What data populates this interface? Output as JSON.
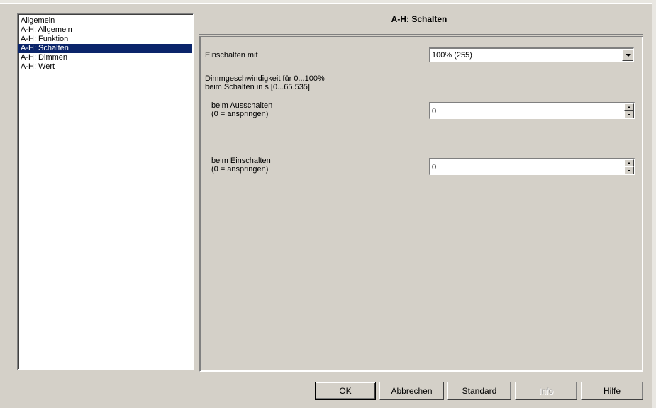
{
  "nav": {
    "items": [
      {
        "label": "Allgemein",
        "selected": false
      },
      {
        "label": "A-H: Allgemein",
        "selected": false
      },
      {
        "label": "A-H: Funktion",
        "selected": false
      },
      {
        "label": "A-H: Schalten",
        "selected": true
      },
      {
        "label": "A-H: Dimmen",
        "selected": false
      },
      {
        "label": "A-H: Wert",
        "selected": false
      }
    ]
  },
  "page": {
    "title": "A-H: Schalten"
  },
  "form": {
    "einschalten_mit": {
      "label": "Einschalten mit",
      "value": "100% (255)"
    },
    "dimm_heading": {
      "line1": "Dimmgeschwindigkeit für 0...100%",
      "line2": "beim Schalten in s [0...65.535]"
    },
    "ausschalten": {
      "label_line1": "beim Ausschalten",
      "label_line2": "(0 = anspringen)",
      "value": "0"
    },
    "einschalten": {
      "label_line1": "beim Einschalten",
      "label_line2": "(0 = anspringen)",
      "value": "0"
    }
  },
  "buttons": {
    "ok": "OK",
    "cancel": "Abbrechen",
    "standard": "Standard",
    "info": "Info",
    "help": "Hilfe"
  },
  "colors": {
    "background": "#d4d0c8",
    "selection": "#0a246a"
  }
}
